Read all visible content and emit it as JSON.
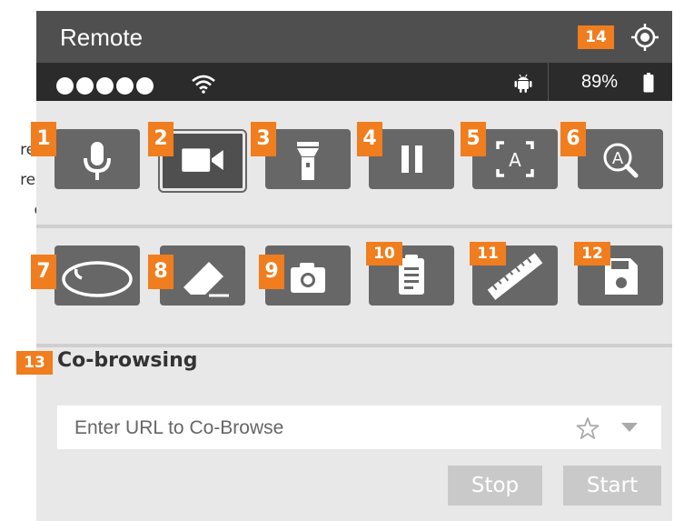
{
  "background_text": {
    "line1": "res",
    "line2": "res",
    "line3": "e"
  },
  "header": {
    "title": "Remote",
    "badge": "14",
    "icon": "crosshair-icon"
  },
  "statusbar": {
    "signal_dots": 5,
    "battery_percent": "89%",
    "icons": [
      "wifi-icon",
      "android-icon",
      "battery-icon"
    ]
  },
  "toolbar_row1": [
    {
      "badge": "1",
      "icon": "microphone-icon"
    },
    {
      "badge": "2",
      "icon": "video-camera-icon",
      "selected": true
    },
    {
      "badge": "3",
      "icon": "flashlight-icon"
    },
    {
      "badge": "4",
      "icon": "pause-icon"
    },
    {
      "badge": "5",
      "icon": "text-recognition-icon",
      "glyph": "A"
    },
    {
      "badge": "6",
      "icon": "text-search-icon",
      "glyph": "A"
    }
  ],
  "toolbar_row2": [
    {
      "badge": "7",
      "icon": "lasso-icon"
    },
    {
      "badge": "8",
      "icon": "eraser-icon"
    },
    {
      "badge": "9",
      "icon": "camera-icon"
    },
    {
      "badge": "10",
      "icon": "clipboard-icon"
    },
    {
      "badge": "11",
      "icon": "ruler-icon"
    },
    {
      "badge": "12",
      "icon": "save-icon"
    }
  ],
  "cobrowsing": {
    "badge": "13",
    "title": "Co-browsing",
    "url_placeholder": "Enter URL to Co-Browse",
    "url_value": "",
    "stop_label": "Stop",
    "start_label": "Start"
  },
  "colors": {
    "accent": "#f07d1e",
    "titlebar": "#4f4f4f",
    "statusbar": "#2b2b2b",
    "button": "#676767",
    "panel": "#e8e8e8",
    "disabled_button": "#c9c9c9"
  }
}
